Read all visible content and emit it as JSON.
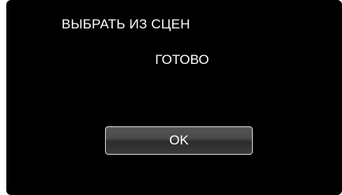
{
  "dialog": {
    "title": "ВЫБРАТЬ ИЗ СЦЕН",
    "status": "ГОТОВО",
    "ok_label": "OK"
  }
}
